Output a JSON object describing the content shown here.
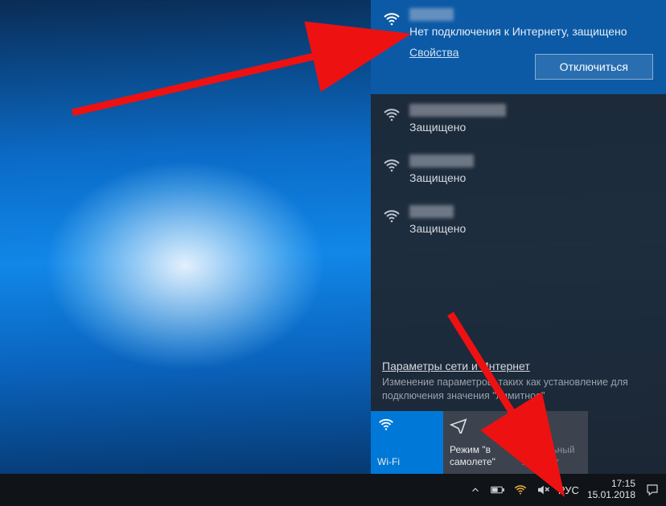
{
  "flyout": {
    "active_network": {
      "status": "Нет подключения к Интернету, защищено",
      "properties_label": "Свойства",
      "disconnect_label": "Отключиться"
    },
    "other_networks": [
      {
        "status": "Защищено"
      },
      {
        "status": "Защищено"
      },
      {
        "status": "Защищено"
      }
    ],
    "settings": {
      "link": "Параметры сети и Интернет",
      "desc": "Изменение параметров, таких как установление для подключения значения \"лимитное\""
    },
    "tiles": {
      "wifi": "Wi-Fi",
      "airplane": "Режим \"в самолете\"",
      "hotspot": "Мобильный хот-спот"
    }
  },
  "taskbar": {
    "lang": "РУС",
    "time": "17:15",
    "date": "15.01.2018"
  },
  "colors": {
    "accent": "#0078d7",
    "active_network_bg": "#0c5aa6"
  }
}
